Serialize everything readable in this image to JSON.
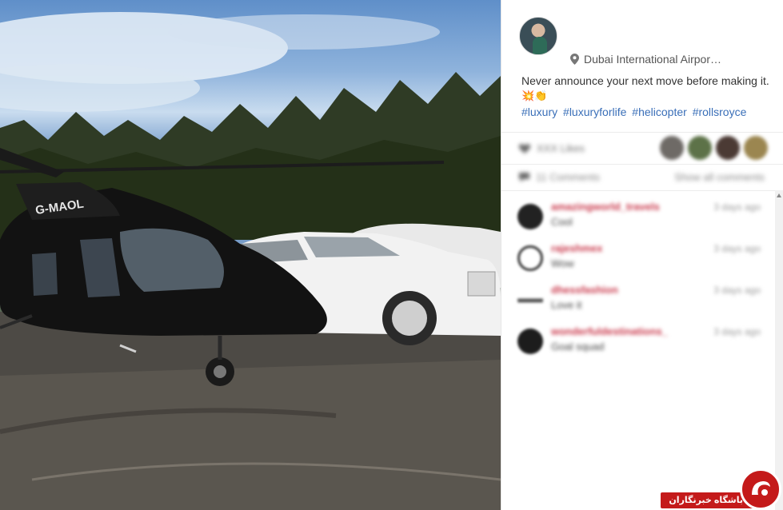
{
  "post": {
    "location": "Dubai International Airpor…",
    "caption": "Never announce your next move before making it.",
    "caption_emojis": "💥👏",
    "hashtags": [
      "#luxury",
      "#luxuryforlife",
      "#helicopter",
      "#rollsroyce"
    ],
    "photo_registration": "G-MAOL",
    "likes_text": "XXX Likes",
    "comments_count": "11 Comments",
    "show_all": "Show all comments"
  },
  "comments": [
    {
      "user": "amazingworld_travels",
      "text": "Cool",
      "time": "3 days ago"
    },
    {
      "user": "rajeshmex",
      "text": "Wow",
      "time": "3 days ago"
    },
    {
      "user": "dhessfashion",
      "text": "Love it",
      "time": "3 days ago"
    },
    {
      "user": "wonderfuldestinations_",
      "text": "Goal squad",
      "time": "3 days ago"
    }
  ],
  "watermark": {
    "text": "باشگاه خبرنگاران"
  },
  "colors": {
    "hashtag": "#3a6fb8",
    "username": "#c9384b",
    "watermark": "#c41a1a"
  },
  "icons": {
    "location": "map-pin-icon",
    "likes": "heart-icon",
    "comments": "comment-bubble-icon"
  }
}
